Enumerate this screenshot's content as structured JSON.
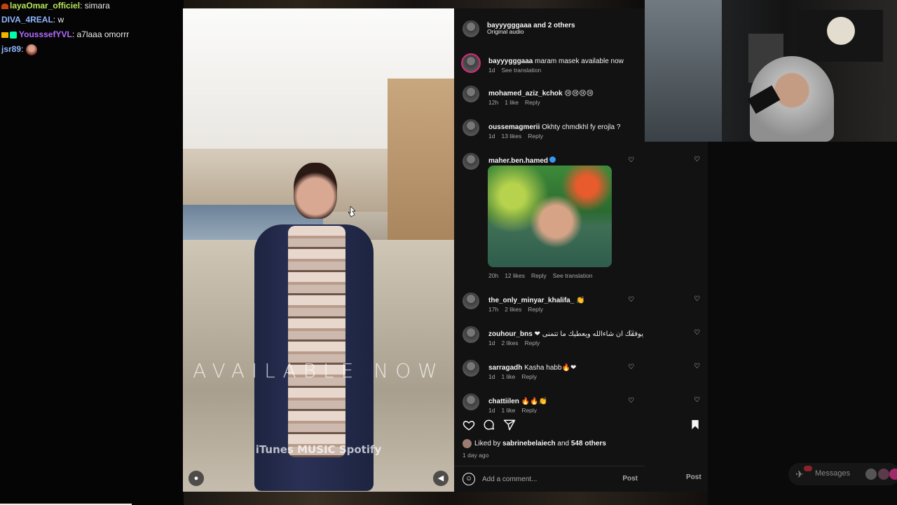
{
  "chat": {
    "lines": [
      {
        "user": "layaOmar_officiel",
        "sep": ":",
        "msg": " simara",
        "color": "#b9e55a"
      },
      {
        "user": "DIVA_4REAL",
        "sep": ":",
        "msg": " w",
        "color": "#8fb7ff"
      },
      {
        "user": "YousssefYVL",
        "sep": ":",
        "msg": " a7laaa omorrr",
        "color": "#b26bff"
      },
      {
        "user": "jsr89",
        "sep": ":",
        "msg": "",
        "color": "#8fb7ff"
      }
    ]
  },
  "video": {
    "overlay_text": "AVAILABLE NOW",
    "stores_text": "iTunes  MUSIC  Spotify"
  },
  "post": {
    "header_user": "bayyygggaaa",
    "header_others": " and 2 others",
    "audio": "Original audio",
    "caption_user": "bayyygggaaa",
    "caption_text": " maram masek available now",
    "caption_time": "1d",
    "caption_translate": "See translation",
    "comments": [
      {
        "user": "mohamed_aziz_kchok",
        "text": " 😢😢😢😢",
        "time": "12h",
        "likes": "1 like",
        "reply": "Reply",
        "heart": false
      },
      {
        "user": "oussemagmerii",
        "text": " Okhty chmdkhl fy erojla ?",
        "time": "1d",
        "likes": "13 likes",
        "reply": "Reply",
        "heart": false
      },
      {
        "user": "maher.ben.hamed",
        "text": "",
        "time": "20h",
        "likes": "12 likes",
        "reply": "Reply",
        "translate": "See translation",
        "heart": true,
        "verified": true
      },
      {
        "user": "the_only_minyar_khalifa_",
        "text": " 👏",
        "time": "17h",
        "likes": "2 likes",
        "reply": "Reply",
        "heart": true
      },
      {
        "user": "zouhour_bns",
        "text": " ❤ ربي يوفقك ان شاءالله ويعطيك ما تتمنى",
        "time": "1d",
        "likes": "2 likes",
        "reply": "Reply",
        "heart": true
      },
      {
        "user": "sarragadh",
        "text": " Kasha habb🔥❤",
        "time": "1d",
        "likes": "1 like",
        "reply": "Reply",
        "heart": true
      },
      {
        "user": "chattiilen",
        "text": " 🔥🔥👏",
        "time": "1d",
        "likes": "1 like",
        "reply": "Reply",
        "heart": true
      }
    ],
    "liked_prefix": "Liked by ",
    "liked_user": "sabrinebelaiech",
    "liked_mid": " and ",
    "liked_count": "548 others",
    "posted_ago": "1 day ago",
    "add_comment_placeholder": "Add a comment...",
    "post_label": "Post"
  },
  "dock": {
    "messages_label": "Messages",
    "badge": "9+"
  },
  "colors": {
    "panel_bg": "#121212",
    "meta_gray": "#a8a8a8",
    "verified_blue": "#3897f0",
    "accent_heart": "#ff3040"
  }
}
